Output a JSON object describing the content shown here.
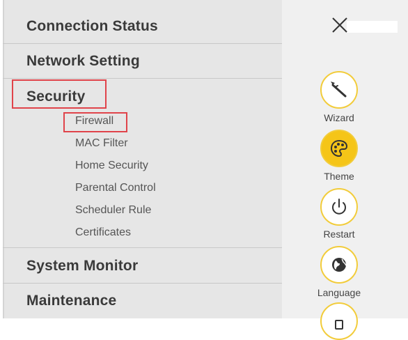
{
  "menu": {
    "items": [
      {
        "label": "Connection Status"
      },
      {
        "label": "Network Setting"
      },
      {
        "label": "Security"
      },
      {
        "label": "System Monitor"
      },
      {
        "label": "Maintenance"
      }
    ],
    "security_sub": [
      {
        "label": "Firewall"
      },
      {
        "label": "MAC Filter"
      },
      {
        "label": "Home Security"
      },
      {
        "label": "Parental Control"
      },
      {
        "label": "Scheduler Rule"
      },
      {
        "label": "Certificates"
      }
    ]
  },
  "side": {
    "buttons": [
      {
        "label": "Wizard",
        "icon": "wand-icon"
      },
      {
        "label": "Theme",
        "icon": "palette-icon"
      },
      {
        "label": "Restart",
        "icon": "power-icon"
      },
      {
        "label": "Language",
        "icon": "globe-icon"
      }
    ]
  },
  "colors": {
    "accent": "#f5c518",
    "highlight": "#e0434a"
  }
}
